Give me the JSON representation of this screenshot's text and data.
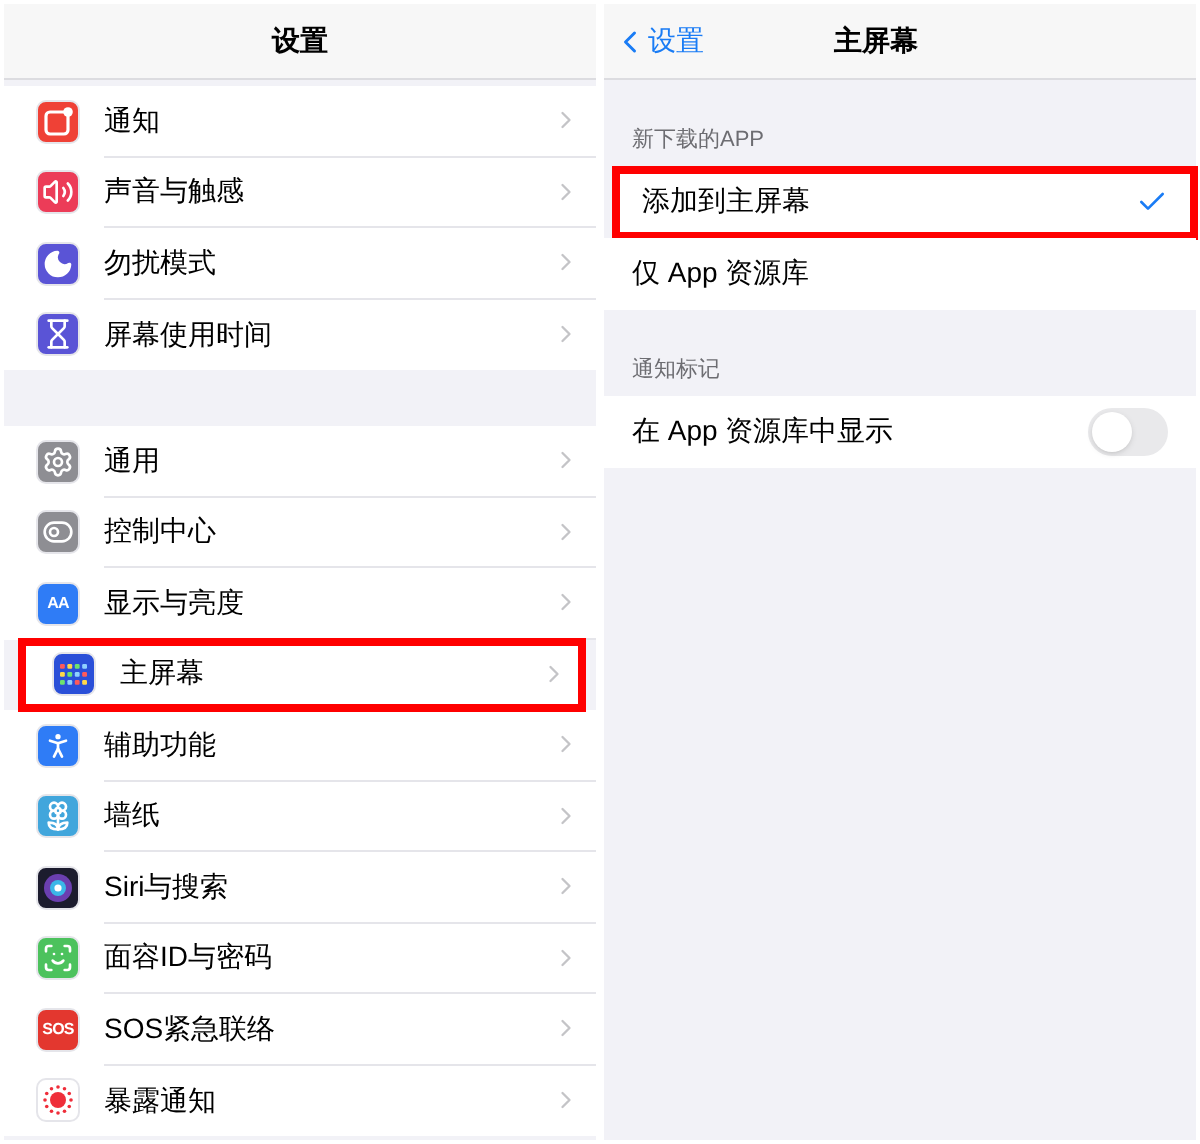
{
  "left": {
    "title": "设置",
    "groups": [
      {
        "items": [
          {
            "label": "通知",
            "kind": "notification",
            "color": "#ef4136",
            "highlighted": false
          },
          {
            "label": "声音与触感",
            "kind": "speaker",
            "color": "#ec3c58",
            "highlighted": false
          },
          {
            "label": "勿扰模式",
            "kind": "moon",
            "color": "#5a54d6",
            "highlighted": false
          },
          {
            "label": "屏幕使用时间",
            "kind": "hourglass",
            "color": "#5a54d6",
            "highlighted": false
          }
        ]
      },
      {
        "items": [
          {
            "label": "通用",
            "kind": "gear",
            "color": "#8e8e93",
            "highlighted": false
          },
          {
            "label": "控制中心",
            "kind": "toggles",
            "color": "#8e8e93",
            "highlighted": false
          },
          {
            "label": "显示与亮度",
            "kind": "text",
            "icon_text": "AA",
            "color": "#2f7cf6",
            "highlighted": false
          },
          {
            "label": "主屏幕",
            "kind": "grid",
            "color": "#2a4fd8",
            "highlighted": true
          },
          {
            "label": "辅助功能",
            "kind": "accessibility",
            "color": "#2f7cf6",
            "highlighted": false
          },
          {
            "label": "墙纸",
            "kind": "flower",
            "color": "#41a6dc",
            "highlighted": false
          },
          {
            "label": "Siri与搜索",
            "kind": "orb",
            "color": "#1c1c2e",
            "highlighted": false
          },
          {
            "label": "面容ID与密码",
            "kind": "face",
            "color": "#4cc25d",
            "highlighted": false
          },
          {
            "label": "SOS紧急联络",
            "kind": "text",
            "icon_text": "SOS",
            "color": "#e3372f",
            "highlighted": false
          },
          {
            "label": "暴露通知",
            "kind": "exposure",
            "color": "#ffffff",
            "highlighted": false
          }
        ]
      }
    ]
  },
  "right": {
    "back": "设置",
    "title": "主屏幕",
    "sections": [
      {
        "header": "新下载的APP",
        "rows": [
          {
            "kind": "option",
            "label": "添加到主屏幕",
            "selected": true,
            "highlighted": true
          },
          {
            "kind": "option",
            "label": "仅 App 资源库",
            "selected": false,
            "highlighted": false
          }
        ]
      },
      {
        "header": "通知标记",
        "rows": [
          {
            "kind": "switch",
            "label": "在 App 资源库中显示",
            "on": false,
            "highlighted": false
          }
        ]
      }
    ]
  }
}
